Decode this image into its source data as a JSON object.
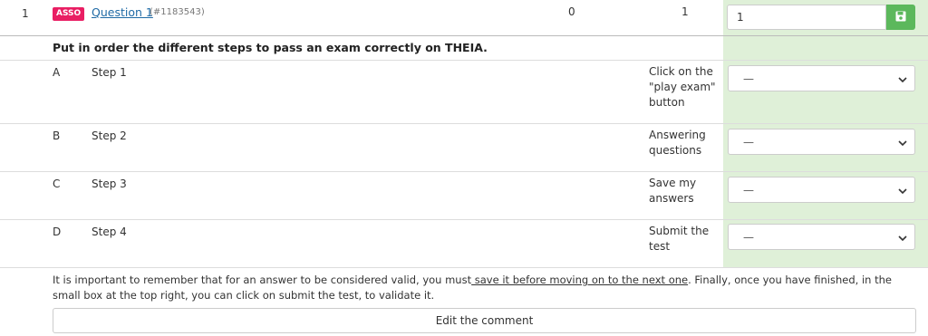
{
  "header": {
    "row_number": "1",
    "badge": "ASSO",
    "question_link": "Question 1",
    "question_id": "(#1183543)",
    "col_a_value": "0",
    "col_b_value": "1",
    "score_value": "1",
    "save_icon": "floppy-disk-icon"
  },
  "question": {
    "title": "Put in order the different steps to pass an exam correctly on THEIA."
  },
  "rows": [
    {
      "letter": "A",
      "step": "Step 1",
      "answer": "Click on the \"play exam\" button",
      "selected": "—"
    },
    {
      "letter": "B",
      "step": "Step 2",
      "answer": "Answering questions",
      "selected": "—"
    },
    {
      "letter": "C",
      "step": "Step 3",
      "answer": "Save my answers",
      "selected": "—"
    },
    {
      "letter": "D",
      "step": "Step 4",
      "answer": "Submit the test",
      "selected": "—"
    }
  ],
  "comment": {
    "part1": "It is important to remember that for an answer to be considered valid, you must",
    "underlined": " save it before moving on to the next one",
    "part2": ". Finally, once you have finished, in the small box at the top right, you can click on submit the test, to validate it."
  },
  "edit_button_label": "Edit the comment",
  "colors": {
    "badge": "#e91e63",
    "save_button": "#5cb85c",
    "answer_column_bg": "#dff0d8",
    "link": "#1f6aa5"
  }
}
